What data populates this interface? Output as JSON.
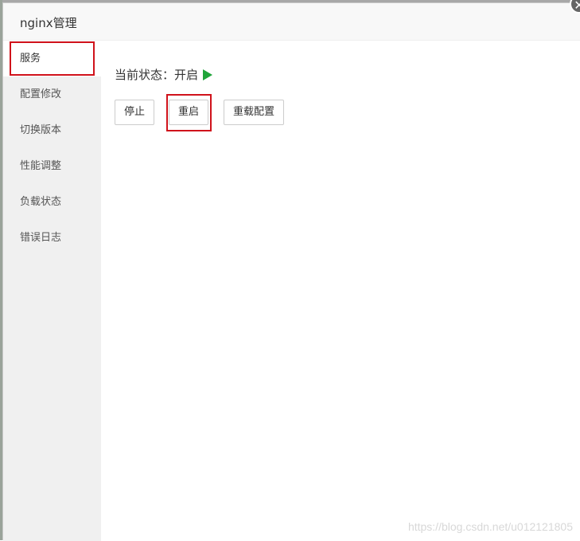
{
  "window": {
    "title": "nginx管理",
    "close_symbol": "✕"
  },
  "sidebar": {
    "items": [
      {
        "label": "服务"
      },
      {
        "label": "配置修改"
      },
      {
        "label": "切换版本"
      },
      {
        "label": "性能调整"
      },
      {
        "label": "负载状态"
      },
      {
        "label": "错误日志"
      }
    ]
  },
  "main": {
    "status_label": "当前状态：",
    "status_value": "开启",
    "buttons": {
      "stop": "停止",
      "restart": "重启",
      "reload": "重载配置"
    }
  },
  "watermark": "https://blog.csdn.net/u012121805",
  "colors": {
    "running": "#20a53a",
    "annotation_red": "#d0121b"
  }
}
